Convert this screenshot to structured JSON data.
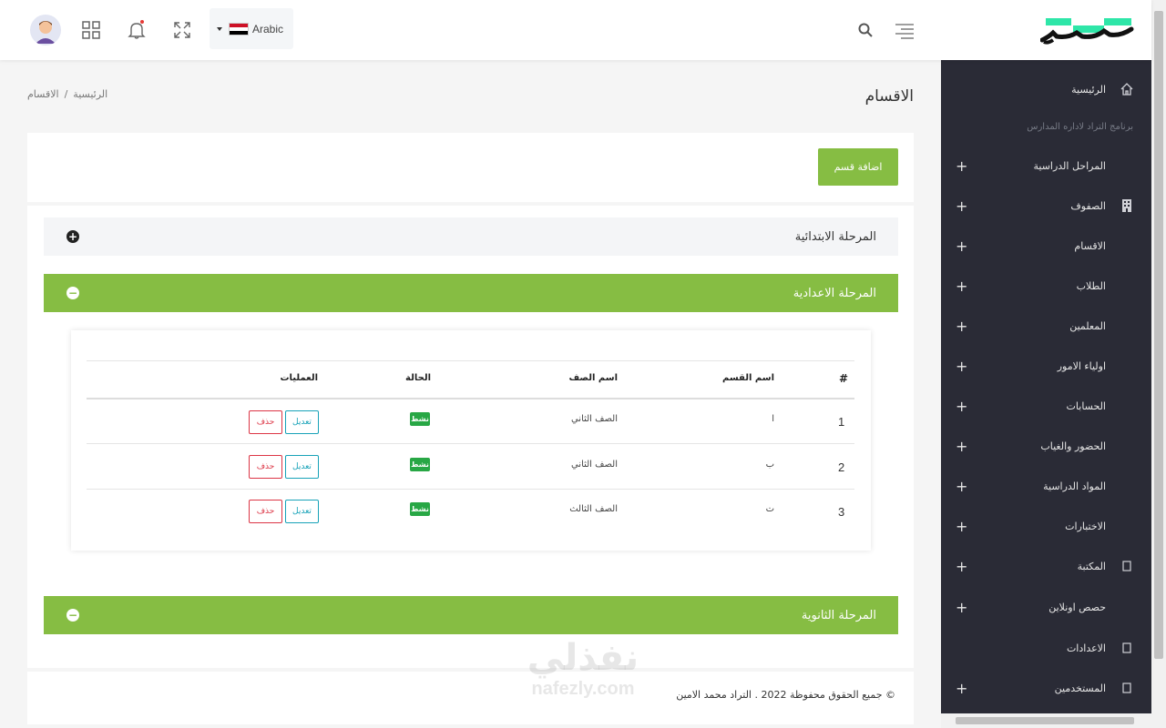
{
  "header": {
    "language": "Arabic",
    "logo_text": "تعلم"
  },
  "page": {
    "title": "الاقسام",
    "breadcrumb": [
      "الرئيسية",
      "/",
      "الاقسام"
    ],
    "add_button": "اضافة قسم"
  },
  "sidebar": {
    "caption": "برنامج التراد لاداره المدارس",
    "items": [
      {
        "label": "الرئيسية",
        "icon": "home-icon",
        "expandable": false
      },
      {
        "label": "المراحل الدراسية",
        "icon": "",
        "expandable": true
      },
      {
        "label": "الصفوف",
        "icon": "building-icon",
        "expandable": true
      },
      {
        "label": "الاقسام",
        "icon": "",
        "expandable": true
      },
      {
        "label": "الطلاب",
        "icon": "",
        "expandable": true
      },
      {
        "label": "المعلمين",
        "icon": "",
        "expandable": true
      },
      {
        "label": "اولياء الامور",
        "icon": "",
        "expandable": true
      },
      {
        "label": "الحسابات",
        "icon": "",
        "expandable": true
      },
      {
        "label": "الحضور والغياب",
        "icon": "",
        "expandable": true
      },
      {
        "label": "المواد الدراسية",
        "icon": "",
        "expandable": true
      },
      {
        "label": "الاختبارات",
        "icon": "",
        "expandable": true
      },
      {
        "label": "المكتبة",
        "icon": "book-icon",
        "expandable": true
      },
      {
        "label": "حصص اونلاين",
        "icon": "",
        "expandable": true
      },
      {
        "label": "الاعدادات",
        "icon": "settings-icon",
        "expandable": false
      },
      {
        "label": "المستخدمين",
        "icon": "users-icon",
        "expandable": true
      }
    ]
  },
  "accordion": [
    {
      "title": "المرحلة الابتدائية",
      "expanded": false
    },
    {
      "title": "المرحلة الاعدادية",
      "expanded": true
    },
    {
      "title": "المرحلة الثانوية",
      "expanded": true
    }
  ],
  "table": {
    "headers": [
      "#",
      "اسم القسم",
      "اسم الصف",
      "الحالة",
      "العمليات"
    ],
    "rows": [
      {
        "num": "1",
        "section": "ا",
        "grade": "الصف الثاني",
        "status": "نشط",
        "edit": "تعديل",
        "delete": "حذف"
      },
      {
        "num": "2",
        "section": "ب",
        "grade": "الصف الثاني",
        "status": "نشط",
        "edit": "تعديل",
        "delete": "حذف"
      },
      {
        "num": "3",
        "section": "ت",
        "grade": "الصف الثالث",
        "status": "نشط",
        "edit": "تعديل",
        "delete": "حذف"
      }
    ]
  },
  "footer": {
    "copyright": "© جميع الحقوق محفوظة 2022 . التراد محمد الامين"
  },
  "watermark": {
    "line1": "نفذلي",
    "line2": "nafezly.com"
  },
  "colors": {
    "accent_green": "#86bd43",
    "sidebar_bg": "#2a2b36",
    "status_green": "#28a745",
    "edit_blue": "#17a2b8",
    "delete_red": "#dc3545"
  }
}
